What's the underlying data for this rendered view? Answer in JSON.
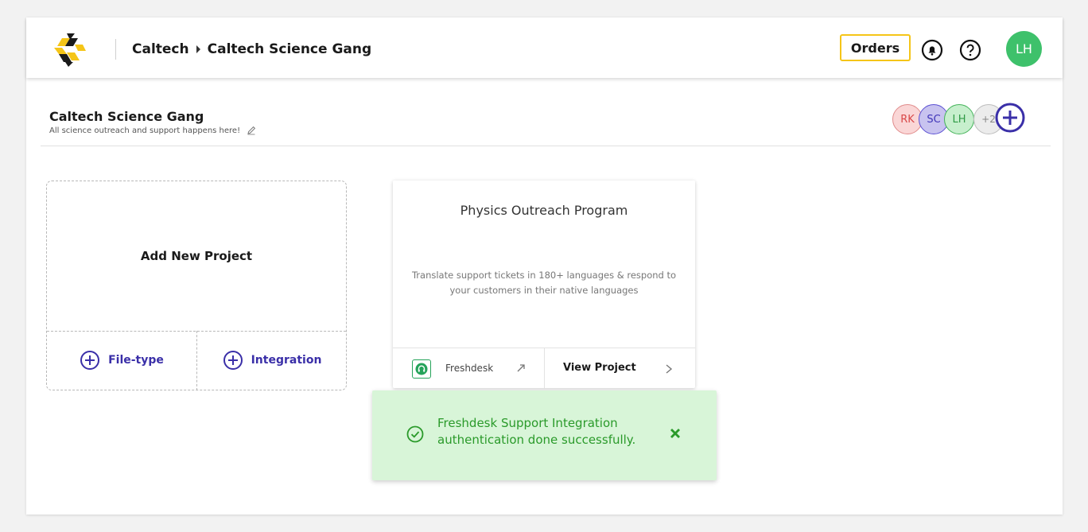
{
  "header": {
    "breadcrumb": {
      "org": "Caltech",
      "workspace": "Caltech Science Gang"
    },
    "orders_label": "Orders",
    "user_initials": "LH",
    "icons": {
      "notifications": "bell-icon",
      "help": "help-circle-icon"
    }
  },
  "workspace": {
    "title": "Caltech Science Gang",
    "description": "All science outreach and support happens here!",
    "members": [
      {
        "initials": "RK",
        "color": "#fad6d6"
      },
      {
        "initials": "SC",
        "color": "#c8c3ef"
      },
      {
        "initials": "LH",
        "color": "#c7efcd"
      }
    ],
    "more_members": "+2"
  },
  "add_project": {
    "title": "Add New Project",
    "file_type_label": "File-type",
    "integration_label": "Integration"
  },
  "project": {
    "title": "Physics Outreach Program",
    "description": "Translate support tickets in 180+ languages & respond to your customers in their native languages",
    "integration_name": "Freshdesk",
    "view_label": "View Project"
  },
  "toast": {
    "message": "Freshdesk Support Integration authentication done successfully.",
    "color": "#2a9a2a",
    "background": "#d8f5d8"
  },
  "colors": {
    "accent": "#3a2fa8",
    "orders_border": "#f5c518",
    "avatar_green": "#3ec16b"
  }
}
